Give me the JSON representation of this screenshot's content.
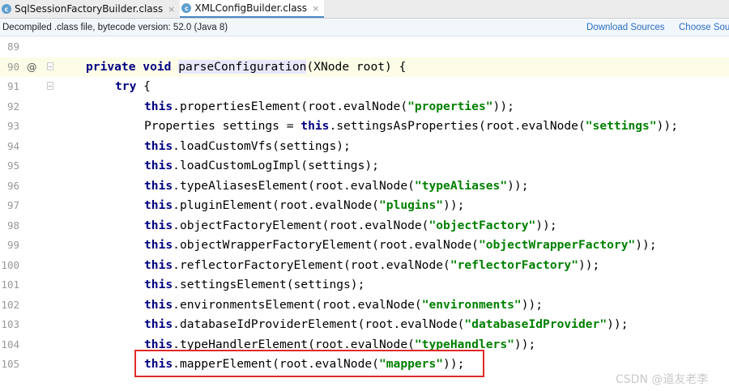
{
  "tabs": [
    {
      "icon": "c",
      "label": "SqlSessionFactoryBuilder.class",
      "close": "×",
      "active": false
    },
    {
      "icon": "c",
      "label": "XMLConfigBuilder.class",
      "close": "×",
      "active": true
    }
  ],
  "banner": {
    "text": "Decompiled .class file, bytecode version: 52.0 (Java 8)",
    "download_sources": "Download Sources",
    "choose_sources": "Choose Sources..."
  },
  "gutter": {
    "override_marker": "@"
  },
  "lines": [
    {
      "num": "89",
      "indent": 0,
      "tokens": []
    },
    {
      "num": "90",
      "indent": 1,
      "current": true,
      "tokens": [
        {
          "t": "private ",
          "c": "kw"
        },
        {
          "t": "void ",
          "c": "kw"
        },
        {
          "t": "parseConfiguration",
          "c": "hl"
        },
        {
          "t": "(XNode root) {",
          "c": ""
        }
      ]
    },
    {
      "num": "91",
      "indent": 2,
      "tokens": [
        {
          "t": "try ",
          "c": "kw"
        },
        {
          "t": "{",
          "c": ""
        }
      ]
    },
    {
      "num": "92",
      "indent": 3,
      "tokens": [
        {
          "t": "this",
          "c": "kw"
        },
        {
          "t": ".propertiesElement(root.evalNode(",
          "c": ""
        },
        {
          "t": "\"properties\"",
          "c": "str"
        },
        {
          "t": "));",
          "c": ""
        }
      ]
    },
    {
      "num": "93",
      "indent": 3,
      "tokens": [
        {
          "t": "Properties settings = ",
          "c": ""
        },
        {
          "t": "this",
          "c": "kw"
        },
        {
          "t": ".settingsAsProperties(root.evalNode(",
          "c": ""
        },
        {
          "t": "\"settings\"",
          "c": "str"
        },
        {
          "t": "));",
          "c": ""
        }
      ]
    },
    {
      "num": "94",
      "indent": 3,
      "tokens": [
        {
          "t": "this",
          "c": "kw"
        },
        {
          "t": ".loadCustomVfs(settings);",
          "c": ""
        }
      ]
    },
    {
      "num": "95",
      "indent": 3,
      "tokens": [
        {
          "t": "this",
          "c": "kw"
        },
        {
          "t": ".loadCustomLogImpl(settings);",
          "c": ""
        }
      ]
    },
    {
      "num": "96",
      "indent": 3,
      "tokens": [
        {
          "t": "this",
          "c": "kw"
        },
        {
          "t": ".typeAliasesElement(root.evalNode(",
          "c": ""
        },
        {
          "t": "\"typeAliases\"",
          "c": "str"
        },
        {
          "t": "));",
          "c": ""
        }
      ]
    },
    {
      "num": "97",
      "indent": 3,
      "tokens": [
        {
          "t": "this",
          "c": "kw"
        },
        {
          "t": ".pluginElement(root.evalNode(",
          "c": ""
        },
        {
          "t": "\"plugins\"",
          "c": "str"
        },
        {
          "t": "));",
          "c": ""
        }
      ]
    },
    {
      "num": "98",
      "indent": 3,
      "tokens": [
        {
          "t": "this",
          "c": "kw"
        },
        {
          "t": ".objectFactoryElement(root.evalNode(",
          "c": ""
        },
        {
          "t": "\"objectFactory\"",
          "c": "str"
        },
        {
          "t": "));",
          "c": ""
        }
      ]
    },
    {
      "num": "99",
      "indent": 3,
      "tokens": [
        {
          "t": "this",
          "c": "kw"
        },
        {
          "t": ".objectWrapperFactoryElement(root.evalNode(",
          "c": ""
        },
        {
          "t": "\"objectWrapperFactory\"",
          "c": "str"
        },
        {
          "t": "));",
          "c": ""
        }
      ]
    },
    {
      "num": "100",
      "indent": 3,
      "tokens": [
        {
          "t": "this",
          "c": "kw"
        },
        {
          "t": ".reflectorFactoryElement(root.evalNode(",
          "c": ""
        },
        {
          "t": "\"reflectorFactory\"",
          "c": "str"
        },
        {
          "t": "));",
          "c": ""
        }
      ]
    },
    {
      "num": "101",
      "indent": 3,
      "tokens": [
        {
          "t": "this",
          "c": "kw"
        },
        {
          "t": ".settingsElement(settings);",
          "c": ""
        }
      ]
    },
    {
      "num": "102",
      "indent": 3,
      "tokens": [
        {
          "t": "this",
          "c": "kw"
        },
        {
          "t": ".environmentsElement(root.evalNode(",
          "c": ""
        },
        {
          "t": "\"environments\"",
          "c": "str"
        },
        {
          "t": "));",
          "c": ""
        }
      ]
    },
    {
      "num": "103",
      "indent": 3,
      "tokens": [
        {
          "t": "this",
          "c": "kw"
        },
        {
          "t": ".databaseIdProviderElement(root.evalNode(",
          "c": ""
        },
        {
          "t": "\"databaseIdProvider\"",
          "c": "str"
        },
        {
          "t": "));",
          "c": ""
        }
      ]
    },
    {
      "num": "104",
      "indent": 3,
      "tokens": [
        {
          "t": "this",
          "c": "kw"
        },
        {
          "t": ".typeHandlerElement(root.evalNode(",
          "c": ""
        },
        {
          "t": "\"typeHandlers\"",
          "c": "str"
        },
        {
          "t": "));",
          "c": ""
        }
      ]
    },
    {
      "num": "105",
      "indent": 3,
      "tokens": [
        {
          "t": "this",
          "c": "kw"
        },
        {
          "t": ".mapperElement(root.evalNode(",
          "c": ""
        },
        {
          "t": "\"mappers\"",
          "c": "str"
        },
        {
          "t": "));",
          "c": ""
        }
      ]
    }
  ],
  "watermark": "CSDN @道友老李",
  "colors": {
    "keyword": "#000080",
    "string": "#008000",
    "highlight_box": "#e02a2a",
    "link": "#2b6cc4"
  }
}
